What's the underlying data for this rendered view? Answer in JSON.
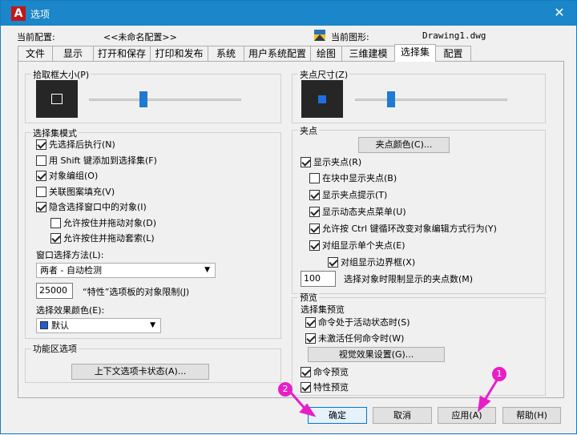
{
  "window": {
    "title": "选项",
    "logo": "A",
    "close_icon": "✕"
  },
  "profile": {
    "label": "当前配置:",
    "value": "<<未命名配置>>"
  },
  "drawing": {
    "label": "当前图形:",
    "value": "Drawing1.dwg",
    "icon": "drawing-file-icon"
  },
  "tabs": [
    "文件",
    "显示",
    "打开和保存",
    "打印和发布",
    "系统",
    "用户系统配置",
    "绘图",
    "三维建模",
    "选择集",
    "配置"
  ],
  "active_tab": "选择集",
  "pickbox": {
    "legend": "拾取框大小(P)",
    "slider_level": 0.35
  },
  "grip_size": {
    "legend": "夹点尺寸(Z)",
    "slider_level": 0.22
  },
  "selection_modes": {
    "legend": "选择集模式",
    "items": [
      {
        "label": "先选择后执行(N)",
        "checked": true
      },
      {
        "label": "用 Shift 键添加到选择集(F)",
        "checked": false
      },
      {
        "label": "对象编组(O)",
        "checked": true
      },
      {
        "label": "关联图案填充(V)",
        "checked": false
      },
      {
        "label": "隐含选择窗口中的对象(I)",
        "checked": true
      },
      {
        "label": "允许按住并拖动对象(D)",
        "checked": false
      },
      {
        "label": "允许按住并拖动套索(L)",
        "checked": true
      }
    ],
    "window_method_label": "窗口选择方法(L):",
    "window_method_value": "两者 - 自动检测",
    "limit_value": "25000",
    "limit_label": "“特性”选项板的对象限制(J)",
    "effect_color_label": "选择效果颜色(E):",
    "effect_color_value": "默认",
    "effect_color_swatch": "#1f5fd1"
  },
  "ribbon": {
    "legend": "功能区选项",
    "button": "上下文选项卡状态(A)..."
  },
  "grips": {
    "legend": "夹点",
    "color_button": "夹点颜色(C)...",
    "items": [
      {
        "label": "显示夹点(R)",
        "checked": true
      },
      {
        "label": "在块中显示夹点(B)",
        "checked": false
      },
      {
        "label": "显示夹点提示(T)",
        "checked": true
      },
      {
        "label": "显示动态夹点菜单(U)",
        "checked": true
      },
      {
        "label": "允许按 Ctrl 键循环改变对象编辑方式行为(Y)",
        "checked": true
      },
      {
        "label": "对组显示单个夹点(E)",
        "checked": true
      },
      {
        "label": "对组显示边界框(X)",
        "checked": true
      }
    ],
    "limit_value": "100",
    "limit_label": "选择对象时限制显示的夹点数(M)"
  },
  "preview": {
    "legend": "预览",
    "sub_legend": "选择集预览",
    "items": [
      {
        "label": "命令处于活动状态时(S)",
        "checked": true
      },
      {
        "label": "未激活任何命令时(W)",
        "checked": true
      }
    ],
    "visual_button": "视觉效果设置(G)...",
    "command_preview": {
      "label": "命令预览",
      "checked": true
    },
    "property_preview": {
      "label": "特性预览",
      "checked": true
    }
  },
  "footer": {
    "ok": "确定",
    "cancel": "取消",
    "apply": "应用(A)",
    "help": "帮助(H)"
  },
  "annotations": {
    "marker1": "1",
    "marker2": "2",
    "color": "#e61fc8"
  }
}
